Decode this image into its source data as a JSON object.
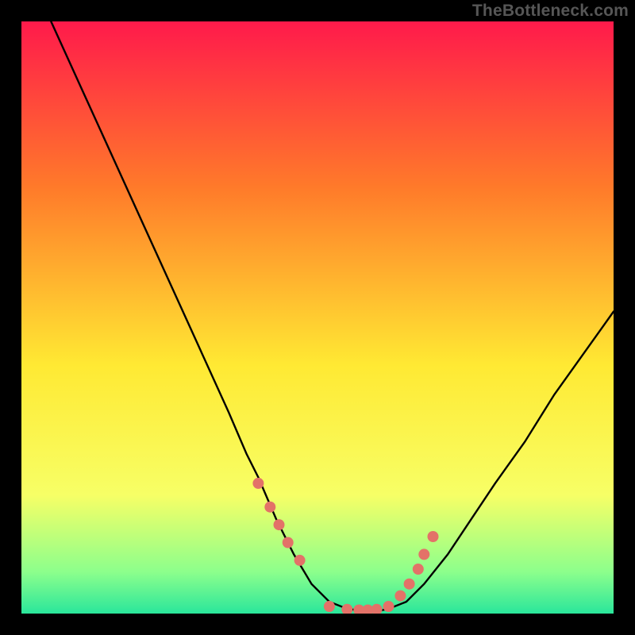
{
  "watermark": "TheBottleneck.com",
  "colors": {
    "gradient_top": "#ff1a4b",
    "gradient_mid_upper": "#ff7a2a",
    "gradient_mid": "#ffe933",
    "gradient_lower": "#f7ff66",
    "gradient_bottom_band": "#8cff8c",
    "gradient_bottom": "#2ae69b",
    "curve": "#000000",
    "markers": "#e37268",
    "frame": "#000000"
  },
  "chart_data": {
    "type": "line",
    "title": "",
    "xlabel": "",
    "ylabel": "",
    "xlim": [
      0,
      100
    ],
    "ylim": [
      0,
      100
    ],
    "curve": {
      "x": [
        5,
        10,
        15,
        20,
        25,
        30,
        35,
        38,
        40,
        43,
        46,
        49,
        52,
        55,
        58,
        60,
        62,
        65,
        68,
        72,
        76,
        80,
        85,
        90,
        95,
        100
      ],
      "y": [
        100,
        89,
        78,
        67,
        56,
        45,
        34,
        27,
        23,
        16,
        10,
        5,
        2,
        0.8,
        0.4,
        0.4,
        0.8,
        2,
        5,
        10,
        16,
        22,
        29,
        37,
        44,
        51
      ]
    },
    "markers": {
      "x": [
        40,
        42,
        43.5,
        45,
        47,
        52,
        55,
        57,
        58.5,
        60,
        62,
        64,
        65.5,
        67,
        68,
        69.5
      ],
      "y": [
        22,
        18,
        15,
        12,
        9,
        1.2,
        0.7,
        0.6,
        0.6,
        0.7,
        1.2,
        3,
        5,
        7.5,
        10,
        13
      ]
    }
  }
}
